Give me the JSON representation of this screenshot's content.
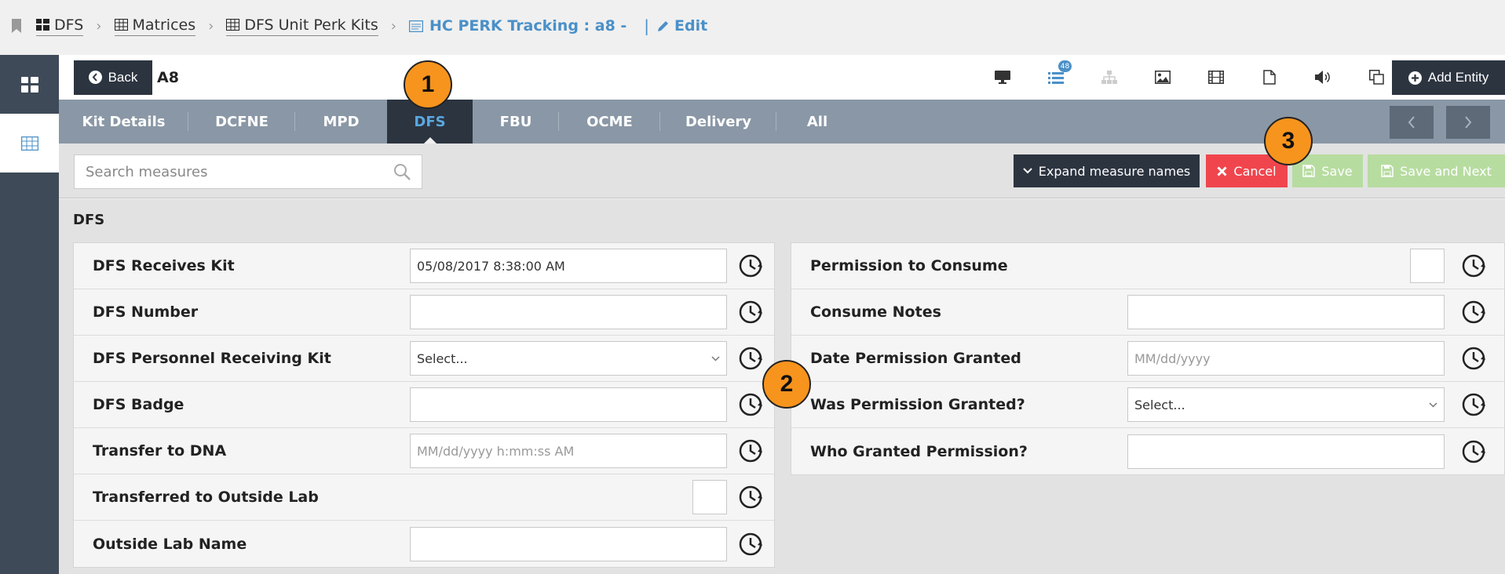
{
  "breadcrumb": {
    "items": [
      "DFS",
      "Matrices",
      "DFS Unit Perk Kits"
    ],
    "current": "HC PERK Tracking : a8  -",
    "edit": "Edit"
  },
  "entity": {
    "back_label": "Back",
    "name": "A8",
    "list_badge": "48",
    "add_entity_label": "Add Entity"
  },
  "tabs": [
    {
      "label": "Kit Details"
    },
    {
      "label": "DCFNE"
    },
    {
      "label": "MPD"
    },
    {
      "label": "DFS"
    },
    {
      "label": "FBU"
    },
    {
      "label": "OCME"
    },
    {
      "label": "Delivery"
    },
    {
      "label": "All"
    }
  ],
  "toolbar": {
    "search_placeholder": "Search measures",
    "expand_label": "Expand measure names",
    "cancel_label": "Cancel",
    "save_label": "Save",
    "save_next_label": "Save and Next"
  },
  "section": {
    "title": "DFS"
  },
  "left_fields": [
    {
      "label": "DFS Receives Kit",
      "value": "05/08/2017 8:38:00 AM"
    },
    {
      "label": "DFS Number",
      "value": ""
    },
    {
      "label": "DFS Personnel Receiving Kit",
      "value": "Select..."
    },
    {
      "label": "DFS Badge",
      "value": ""
    },
    {
      "label": "Transfer to DNA",
      "placeholder": "MM/dd/yyyy h:mm:ss AM"
    },
    {
      "label": "Transferred to Outside Lab"
    },
    {
      "label": "Outside Lab Name",
      "value": ""
    }
  ],
  "right_fields": [
    {
      "label": "Permission to Consume"
    },
    {
      "label": "Consume Notes",
      "value": ""
    },
    {
      "label": "Date Permission Granted",
      "placeholder": "MM/dd/yyyy"
    },
    {
      "label": "Was Permission Granted?",
      "value": "Select..."
    },
    {
      "label": "Who Granted Permission?",
      "value": ""
    }
  ],
  "annotations": [
    "1",
    "2",
    "3"
  ],
  "colors": {
    "accent": "#4a90c8",
    "dark": "#2c3440",
    "tabbar": "#8a97a6",
    "cancel": "#f0454d",
    "save": "#b7dca0",
    "annotation": "#f7941d"
  }
}
